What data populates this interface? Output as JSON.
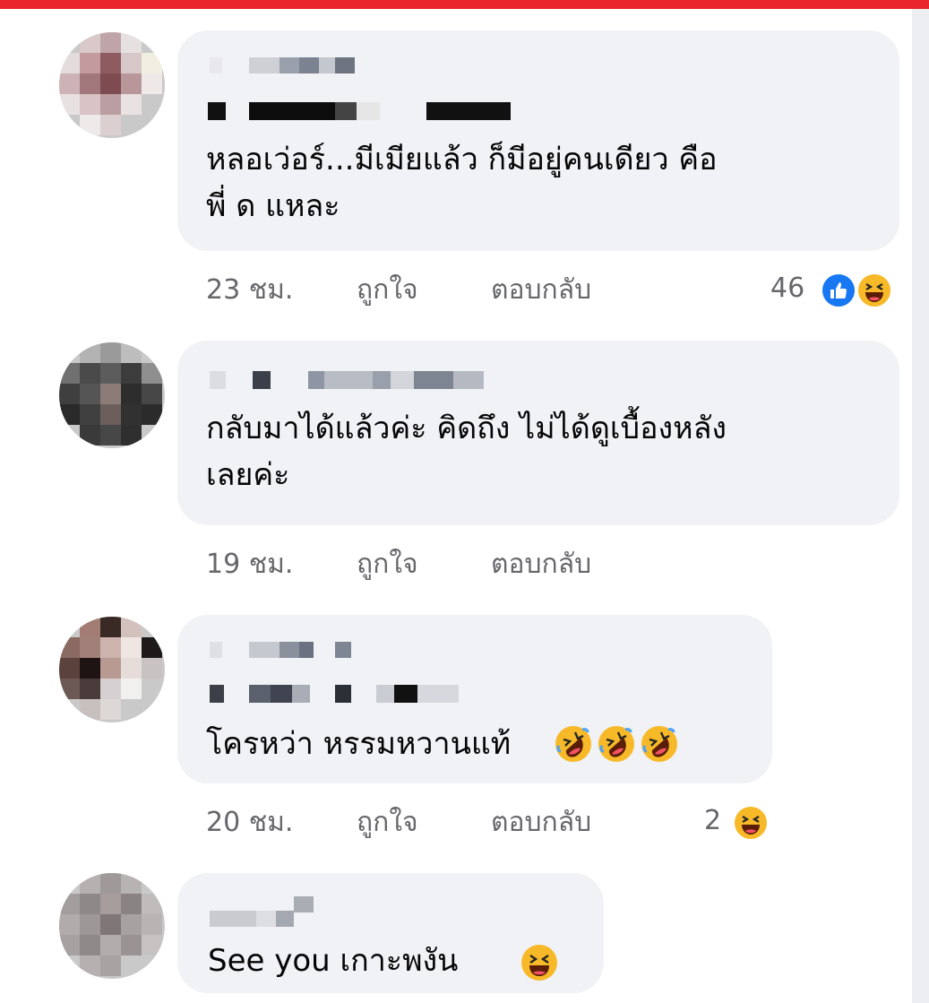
{
  "colors": {
    "accent_bar": "#e8262c",
    "bubble": "#f0f2f5",
    "meta_text": "#65676b",
    "like": "#1877f2",
    "haha": "#f7b928"
  },
  "comments": [
    {
      "text_lines": [
        "หลอเว่อร์...มีเมียแล้ว ก็มีอยู่คนเดียว คือ",
        "พี่ ด แหละ"
      ],
      "time": "23 ชม.",
      "like_label": "ถูกใจ",
      "reply_label": "ตอบกลับ",
      "reaction_count": "46",
      "reaction_icons": [
        "like-icon",
        "haha-icon"
      ]
    },
    {
      "text_lines": [
        "กลับมาได้แล้วค่ะ คิดถึง ไม่ได้ดูเบื้องหลัง",
        "เลยค่ะ"
      ],
      "time": "19 ชม.",
      "like_label": "ถูกใจ",
      "reply_label": "ตอบกลับ"
    },
    {
      "text_lines": [
        "โครหว่า หรรมหวานแท้"
      ],
      "trailing_emoji": [
        "rofl-icon",
        "rofl-icon",
        "rofl-icon"
      ],
      "time": "20 ชม.",
      "like_label": "ถูกใจ",
      "reply_label": "ตอบกลับ",
      "reaction_count": "2",
      "reaction_icons": [
        "haha-icon"
      ]
    },
    {
      "text_lines": [
        "See you เกาะพงัน"
      ],
      "trailing_emoji": [
        "laughing-icon"
      ]
    }
  ]
}
